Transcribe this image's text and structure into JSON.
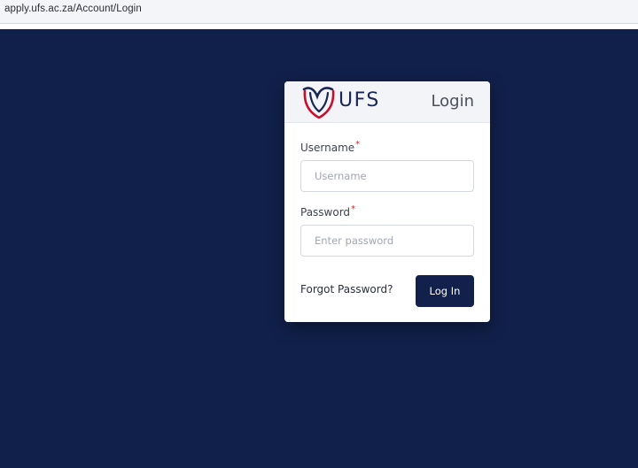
{
  "browser": {
    "url": "apply.ufs.ac.za/Account/Login"
  },
  "colors": {
    "page_background": "#11204a",
    "button_background": "#12214b",
    "required_marker": "#d8232a",
    "logo_red": "#c8102e",
    "logo_navy": "#1a2755"
  },
  "card": {
    "logo_text": "UFS",
    "logo_icon": "ufs-shield-logo",
    "title": "Login",
    "username": {
      "label": "Username",
      "required_marker": "*",
      "placeholder": "Username",
      "value": ""
    },
    "password": {
      "label": "Password",
      "required_marker": "*",
      "placeholder": "Enter password",
      "value": ""
    },
    "forgot_password_label": "Forgot Password?",
    "login_button_label": "Log In"
  }
}
